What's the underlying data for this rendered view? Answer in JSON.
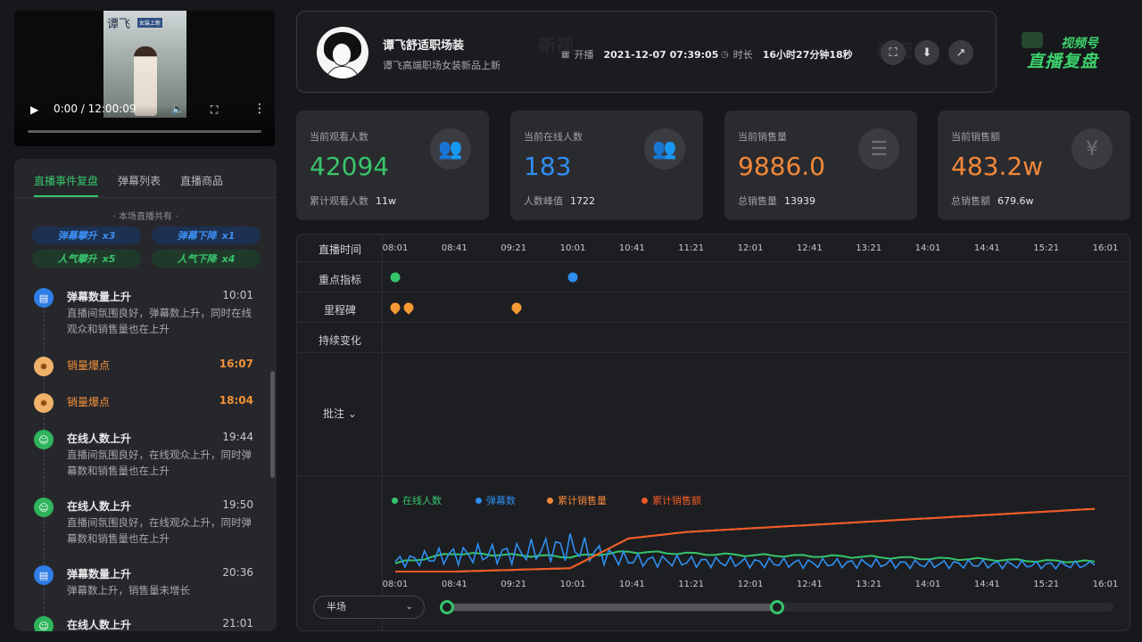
{
  "video": {
    "poster_title": "谭飞",
    "poster_sub": "女装上新",
    "time": "0:00 / 12:00:09",
    "progress": 0
  },
  "left_panel": {
    "tabs": [
      "直播事件复盘",
      "弹幕列表",
      "直播商品"
    ],
    "active_tab": 0,
    "summary_title": "· 本场直播共有 ·",
    "chips": [
      {
        "label": "弹幕攀升",
        "count": "x3",
        "color": "blue"
      },
      {
        "label": "弹幕下降",
        "count": "x1",
        "color": "blue"
      },
      {
        "label": "人气攀升",
        "count": "x5",
        "color": "green"
      },
      {
        "label": "人气下降",
        "count": "x4",
        "color": "green"
      }
    ],
    "events": [
      {
        "type": "blue",
        "icon": "danmaku-icon",
        "title": "弹幕数量上升",
        "time": "10:01",
        "desc": "直播间氛围良好，弹幕数上升，同时在线观众和销售量也在上升",
        "hot": false
      },
      {
        "type": "orange",
        "icon": "sales-burst-icon",
        "title": "销量爆点",
        "time": "16:07",
        "desc": "",
        "hot": true
      },
      {
        "type": "orange",
        "icon": "sales-burst-icon",
        "title": "销量爆点",
        "time": "18:04",
        "desc": "",
        "hot": true
      },
      {
        "type": "green",
        "icon": "online-users-icon",
        "title": "在线人数上升",
        "time": "19:44",
        "desc": "直播间氛围良好，在线观众上升，同时弹幕数和销售量也在上升",
        "hot": false
      },
      {
        "type": "green",
        "icon": "online-users-icon",
        "title": "在线人数上升",
        "time": "19:50",
        "desc": "直播间氛围良好，在线观众上升，同时弹幕数和销售量也在上升",
        "hot": false
      },
      {
        "type": "blue",
        "icon": "danmaku-icon",
        "title": "弹幕数量上升",
        "time": "20:36",
        "desc": "弹幕数上升，销售量未增长",
        "hot": false
      },
      {
        "type": "green",
        "icon": "online-users-icon",
        "title": "在线人数上升",
        "time": "21:01",
        "desc": "",
        "hot": false
      }
    ]
  },
  "header": {
    "shop_name": "谭飞舒适职场装",
    "shop_desc": "谭飞高端职场女装新品上新",
    "start_label": "开播",
    "start_value": "2021-12-07 07:39:05",
    "duration_label": "时长",
    "duration_value": "16小时27分钟18秒",
    "watermark": "新视"
  },
  "logo": {
    "line1": "视频号",
    "line2": "直播复盘"
  },
  "cards": [
    {
      "title": "当前观看人数",
      "value": "42094",
      "sub_label": "累计观看人数",
      "sub_value": "11w",
      "color": "#3ac46b",
      "icon": "users-icon"
    },
    {
      "title": "当前在线人数",
      "value": "183",
      "sub_label": "人数峰值",
      "sub_value": "1722",
      "color": "#2f8ef0",
      "icon": "users-icon"
    },
    {
      "title": "当前销售量",
      "value": "9886.0",
      "sub_label": "总销售量",
      "sub_value": "13939",
      "color": "#f2883a",
      "icon": "stack-icon"
    },
    {
      "title": "当前销售额",
      "value": "483.2w",
      "sub_label": "总销售额",
      "sub_value": "679.6w",
      "color": "#f2883a",
      "icon": "yen-icon"
    }
  ],
  "timeline": {
    "row_labels": {
      "time": "直播时间",
      "key": "重点指标",
      "milestone": "里程碑",
      "change": "持续变化",
      "note": "批注"
    },
    "ticks": [
      "08:01",
      "08:41",
      "09:21",
      "10:01",
      "10:41",
      "11:21",
      "12:01",
      "12:41",
      "13:21",
      "14:01",
      "14:41",
      "15:21",
      "16:01"
    ],
    "key_events": [
      {
        "time": "08:01",
        "color": "#35c46b"
      },
      {
        "time": "10:01",
        "color": "#2f8ef0"
      }
    ],
    "milestones": [
      "08:01",
      "08:10",
      "09:23"
    ],
    "legend": [
      {
        "name": "在线人数",
        "color": "#35c46b"
      },
      {
        "name": "弹幕数",
        "color": "#2f8ef0"
      },
      {
        "name": "累计销售量",
        "color": "#f2883a"
      },
      {
        "name": "累计销售额",
        "color": "#f05a28"
      }
    ],
    "zoom_select": "半场",
    "zoom_range": [
      0.0,
      0.5
    ]
  },
  "chart_data": {
    "type": "line",
    "x": [
      "08:01",
      "08:41",
      "09:21",
      "10:01",
      "10:41",
      "11:21",
      "12:01",
      "12:41",
      "13:21",
      "14:01",
      "14:41",
      "15:21",
      "16:01"
    ],
    "series": [
      {
        "name": "在线人数",
        "values": [
          10,
          22,
          20,
          18,
          24,
          22,
          20,
          19,
          18,
          16,
          15,
          13,
          12
        ]
      },
      {
        "name": "弹幕数",
        "values": [
          12,
          20,
          22,
          30,
          14,
          12,
          11,
          10,
          10,
          9,
          9,
          8,
          8
        ]
      },
      {
        "name": "累计销售量",
        "values": [
          0,
          0,
          2,
          4,
          40,
          48,
          52,
          56,
          60,
          64,
          68,
          72,
          76
        ]
      },
      {
        "name": "累计销售额",
        "values": [
          0,
          0,
          2,
          4,
          40,
          48,
          52,
          56,
          60,
          64,
          68,
          72,
          76
        ]
      }
    ]
  }
}
